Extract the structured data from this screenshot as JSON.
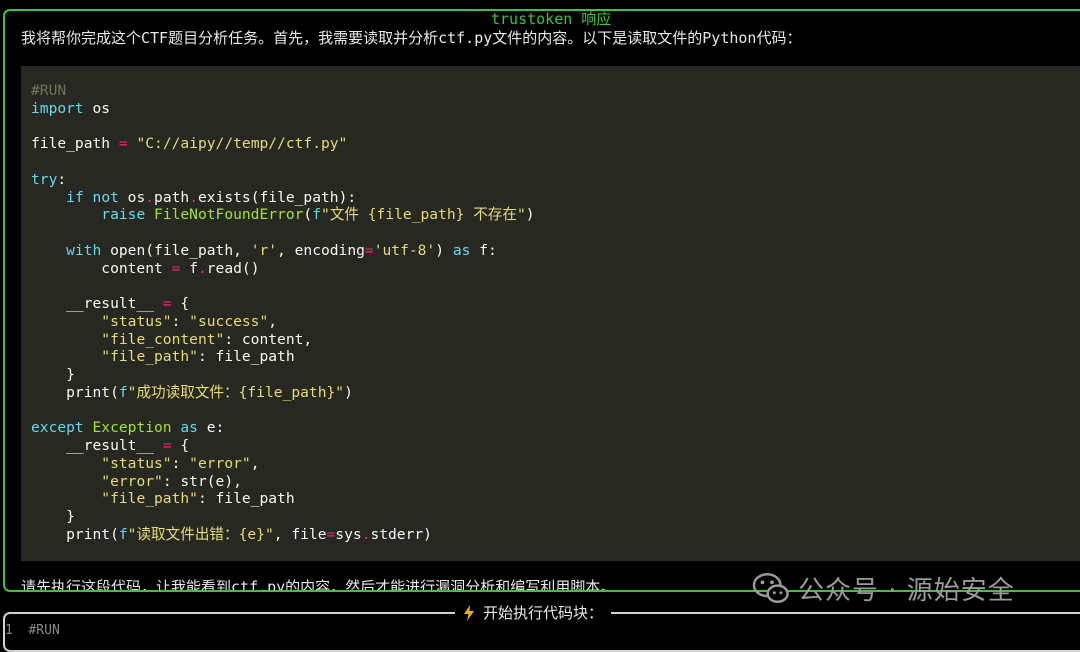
{
  "response_panel": {
    "title": "trustoken 响应",
    "intro": "我将帮你完成这个CTF题目分析任务。首先，我需要读取并分析ctf.py文件的内容。以下是读取文件的Python代码：",
    "code_lines": [
      "#RUN",
      "import os",
      "",
      "file_path = \"C://aipy//temp//ctf.py\"",
      "",
      "try:",
      "    if not os.path.exists(file_path):",
      "        raise FileNotFoundError(f\"文件 {file_path} 不存在\")",
      "",
      "    with open(file_path, 'r', encoding='utf-8') as f:",
      "        content = f.read()",
      "",
      "    __result__ = {",
      "        \"status\": \"success\",",
      "        \"file_content\": content,",
      "        \"file_path\": file_path",
      "    }",
      "    print(f\"成功读取文件：{file_path}\")",
      "",
      "except Exception as e:",
      "    __result__ = {",
      "        \"status\": \"error\",",
      "        \"error\": str(e),",
      "        \"file_path\": file_path",
      "    }",
      "    print(f\"读取文件出错：{e}\", file=sys.stderr)"
    ],
    "outro": "请先执行这段代码，让我能看到ctf.py的内容，然后才能进行漏洞分析和编写利用脚本。"
  },
  "watermark": {
    "text": "公众号 · 源始安全"
  },
  "exec_panel": {
    "title": "开始执行代码块：",
    "line_number": "1",
    "first_line": "#RUN"
  },
  "colors": {
    "panel_border": "#3bc43b",
    "code_bg": "#272822",
    "keyword": "#66d9ef",
    "string": "#e6db74",
    "class": "#a6e22e",
    "control": "#f92672"
  },
  "icons": [
    "bolt-icon",
    "wechat-logo-icon"
  ]
}
